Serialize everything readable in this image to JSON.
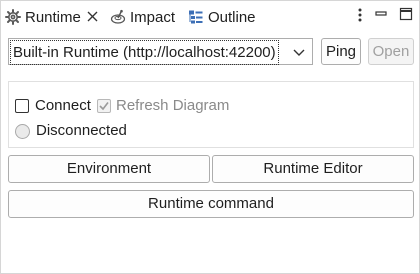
{
  "tabs": [
    {
      "label": "Runtime",
      "icon": "gear-icon",
      "active": true
    },
    {
      "label": "Impact",
      "icon": "impact-icon"
    },
    {
      "label": "Outline",
      "icon": "outline-icon"
    }
  ],
  "runtime_select": {
    "value": "Built-in Runtime (http://localhost:42200)"
  },
  "buttons": {
    "ping": "Ping",
    "open": "Open",
    "environment": "Environment",
    "runtime_editor": "Runtime Editor",
    "runtime_command": "Runtime command"
  },
  "status": {
    "connect_label": "Connect",
    "connect_checked": false,
    "refresh_label": "Refresh Diagram",
    "refresh_checked": true,
    "refresh_enabled": false,
    "state_label": "Disconnected"
  },
  "colors": {
    "text": "#1f1f1f",
    "disabled_text": "#8a8a8a",
    "border": "#adadad",
    "icon_blue": "#3d6fb6"
  }
}
